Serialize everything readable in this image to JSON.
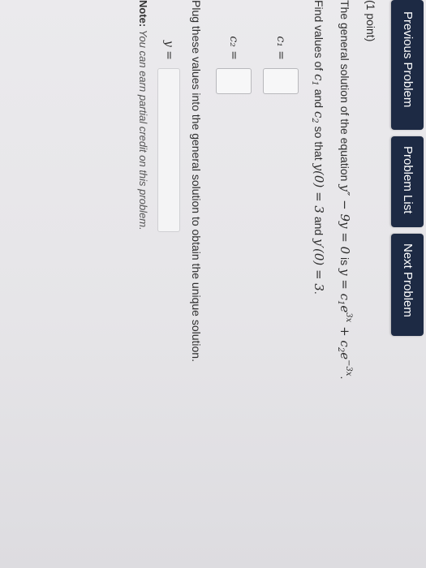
{
  "nav": {
    "previous": "Previous Problem",
    "list": "Problem List",
    "next": "Next Problem"
  },
  "problem": {
    "points": "(1 point)",
    "statement_prefix": "The general solution of the equation ",
    "equation": "y″ − 9y = 0",
    "statement_mid": " is ",
    "general_solution_prefix": "y = c",
    "general_solution_sub1": "1",
    "exp1_base": "e",
    "exp1_power": "3x",
    "plus": " + c",
    "general_solution_sub2": "2",
    "exp2_base": "e",
    "exp2_power": "−3x",
    "period": ".",
    "find_prefix": "Find values of ",
    "c1": "c",
    "c1_sub": "1",
    "and": " and ",
    "c2": "c",
    "c2_sub": "2",
    "so_that": " so that ",
    "cond1": "y(0) = 3",
    "and2": " and ",
    "cond2": "y′(0) = 3",
    "find_end": ".",
    "c1_label": "c₁ =",
    "c2_label": "c₂ =",
    "instruction": "Plug these values into the general solution to obtain the unique solution.",
    "y_label": "y ="
  },
  "note": {
    "label": "Note:",
    "text": " You can earn partial credit on this problem."
  },
  "colors": {
    "nav_bg": "#1d2a44",
    "nav_text": "#ffffff",
    "page_bg": "#e6e5e8"
  }
}
